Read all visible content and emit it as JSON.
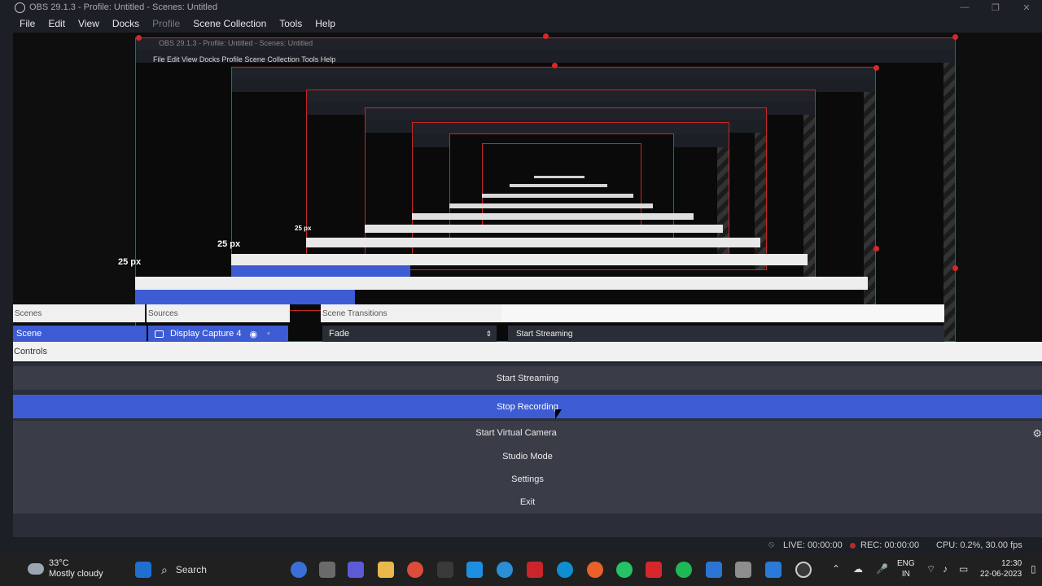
{
  "window": {
    "title": "OBS 29.1.3 - Profile: Untitled - Scenes: Untitled",
    "minimize": "—",
    "maximize": "❐",
    "close": "✕"
  },
  "menu": [
    "File",
    "Edit",
    "View",
    "Docks",
    "Profile",
    "Scene Collection",
    "Tools",
    "Help"
  ],
  "preview": {
    "nested_title": "OBS 29.1.3 - Profile: Untitled - Scenes: Untitled",
    "nested_menu": "File   Edit   View   Docks   Profile   Scene Collection   Tools   Help",
    "px_labels": [
      "25 px",
      "25 px",
      "25 px"
    ]
  },
  "docks": {
    "scenes_header": "Scenes",
    "scene_item": "Scene",
    "sources_header": "Sources",
    "source_item": "Display Capture 4",
    "transitions_header": "Scene Transitions",
    "transition_value": "Fade",
    "stream_mini": "Start Streaming"
  },
  "controls": {
    "header": "Controls",
    "start_streaming": "Start Streaming",
    "stop_recording": "Stop Recording",
    "start_virtual_camera": "Start Virtual Camera",
    "studio_mode": "Studio Mode",
    "settings": "Settings",
    "exit": "Exit"
  },
  "status": {
    "live": "LIVE: 00:00:00",
    "rec": "REC: 00:00:00",
    "cpu": "CPU: 0.2%, 30.00 fps"
  },
  "taskbar": {
    "temperature": "33°C",
    "weather": "Mostly cloudy",
    "search": "Search",
    "lang_top": "ENG",
    "lang_bottom": "IN",
    "time": "12:30",
    "date": "22-06-2023"
  }
}
